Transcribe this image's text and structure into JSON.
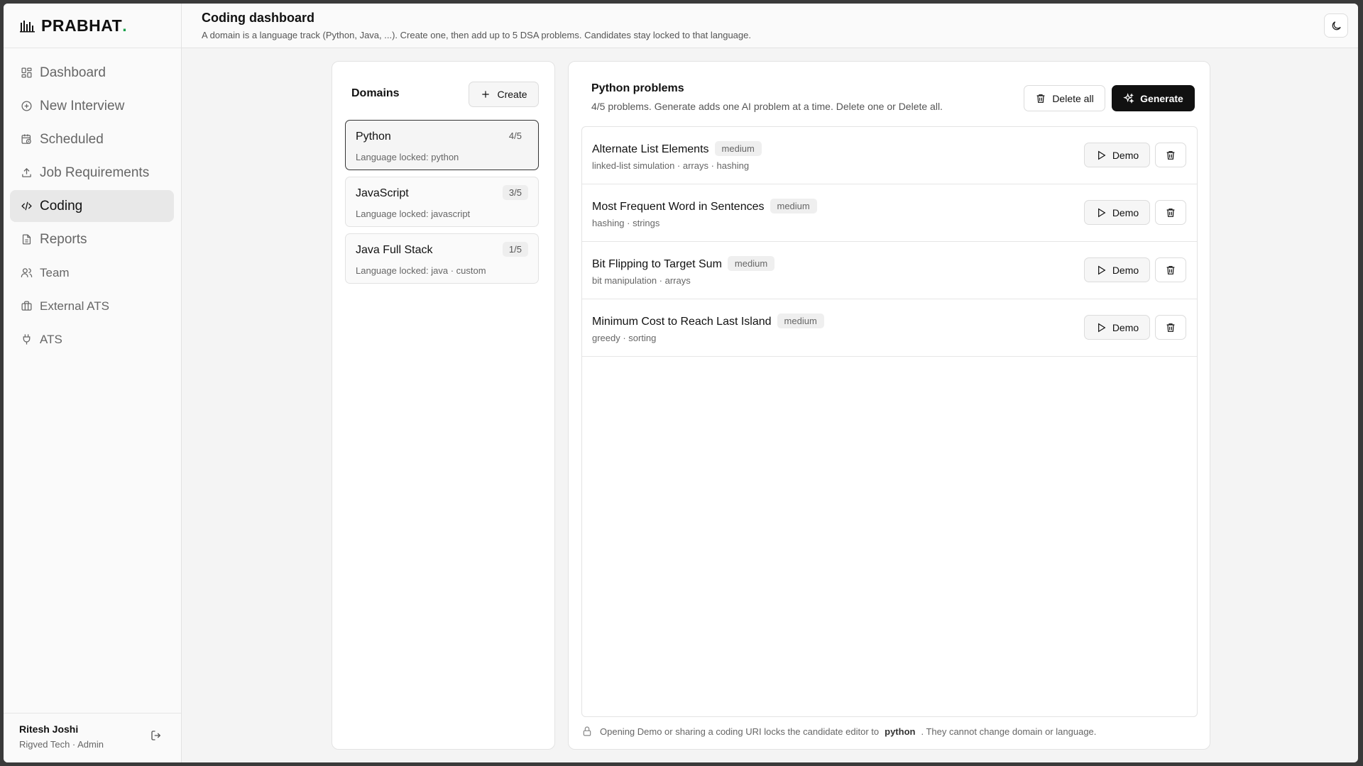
{
  "brand": {
    "name": "PRABHAT",
    "dot": "."
  },
  "nav": [
    {
      "label": "Dashboard",
      "icon": "grid-icon"
    },
    {
      "label": "New Interview",
      "icon": "plus-circle-icon"
    },
    {
      "label": "Scheduled",
      "icon": "calendar-clock-icon"
    },
    {
      "label": "Job Requirements",
      "icon": "upload-icon"
    },
    {
      "label": "Coding",
      "icon": "code-icon",
      "active": true
    },
    {
      "label": "Reports",
      "icon": "file-text-icon"
    },
    {
      "label": "Team",
      "icon": "users-icon"
    },
    {
      "label": "External ATS",
      "icon": "briefcase-icon"
    },
    {
      "label": "ATS",
      "icon": "plug-icon"
    }
  ],
  "user": {
    "name": "Ritesh Joshi",
    "org": "Rigved Tech · Admin"
  },
  "header": {
    "title": "Coding dashboard",
    "subtitle": "A domain is a language track (Python, Java, ...). Create one, then add up to 5 DSA problems. Candidates stay locked to that language."
  },
  "domains": {
    "title": "Domains",
    "create_label": "Create",
    "items": [
      {
        "name": "Python",
        "count": "4/5",
        "meta": "Language locked: python",
        "selected": true
      },
      {
        "name": "JavaScript",
        "count": "3/5",
        "meta": "Language locked: javascript"
      },
      {
        "name": "Java Full Stack",
        "count": "1/5",
        "meta": "Language locked: java · custom"
      }
    ]
  },
  "problems": {
    "title": "Python problems",
    "subtitle": "4/5 problems. Generate adds one AI problem at a time. Delete one or Delete all.",
    "delete_all_label": "Delete all",
    "generate_label": "Generate",
    "demo_label": "Demo",
    "items": [
      {
        "name": "Alternate List Elements",
        "difficulty": "medium",
        "tags": "linked-list simulation · arrays · hashing"
      },
      {
        "name": "Most Frequent Word in Sentences",
        "difficulty": "medium",
        "tags": "hashing · strings"
      },
      {
        "name": "Bit Flipping to Target Sum",
        "difficulty": "medium",
        "tags": "bit manipulation · arrays"
      },
      {
        "name": "Minimum Cost to Reach Last Island",
        "difficulty": "medium",
        "tags": "greedy · sorting"
      }
    ],
    "footer_pre": "Opening Demo or sharing a coding URI locks the candidate editor to",
    "footer_lang": "python",
    "footer_post": ". They cannot change domain or language."
  },
  "colors": {
    "accent": "#111111",
    "brand_dot": "#16a34a",
    "active_nav": "#e8e8e8"
  }
}
